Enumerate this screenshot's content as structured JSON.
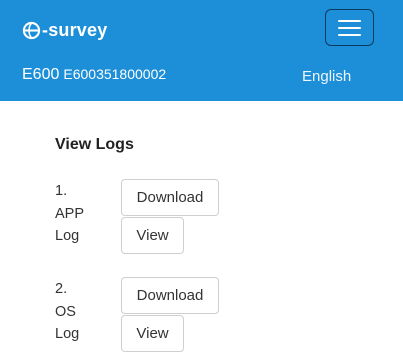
{
  "header": {
    "brand": "-survey",
    "menu_icon": "hamburger-menu-icon",
    "device_model": "E600",
    "device_serial": "E600351800002",
    "language": "English",
    "bg_color": "#1c8fd8"
  },
  "main": {
    "title": "View Logs",
    "logs": [
      {
        "number": "1.",
        "name": "APP",
        "suffix": "Log",
        "download_label": "Download",
        "view_label": "View"
      },
      {
        "number": "2.",
        "name": "OS",
        "suffix": "Log",
        "download_label": "Download",
        "view_label": "View"
      }
    ]
  }
}
